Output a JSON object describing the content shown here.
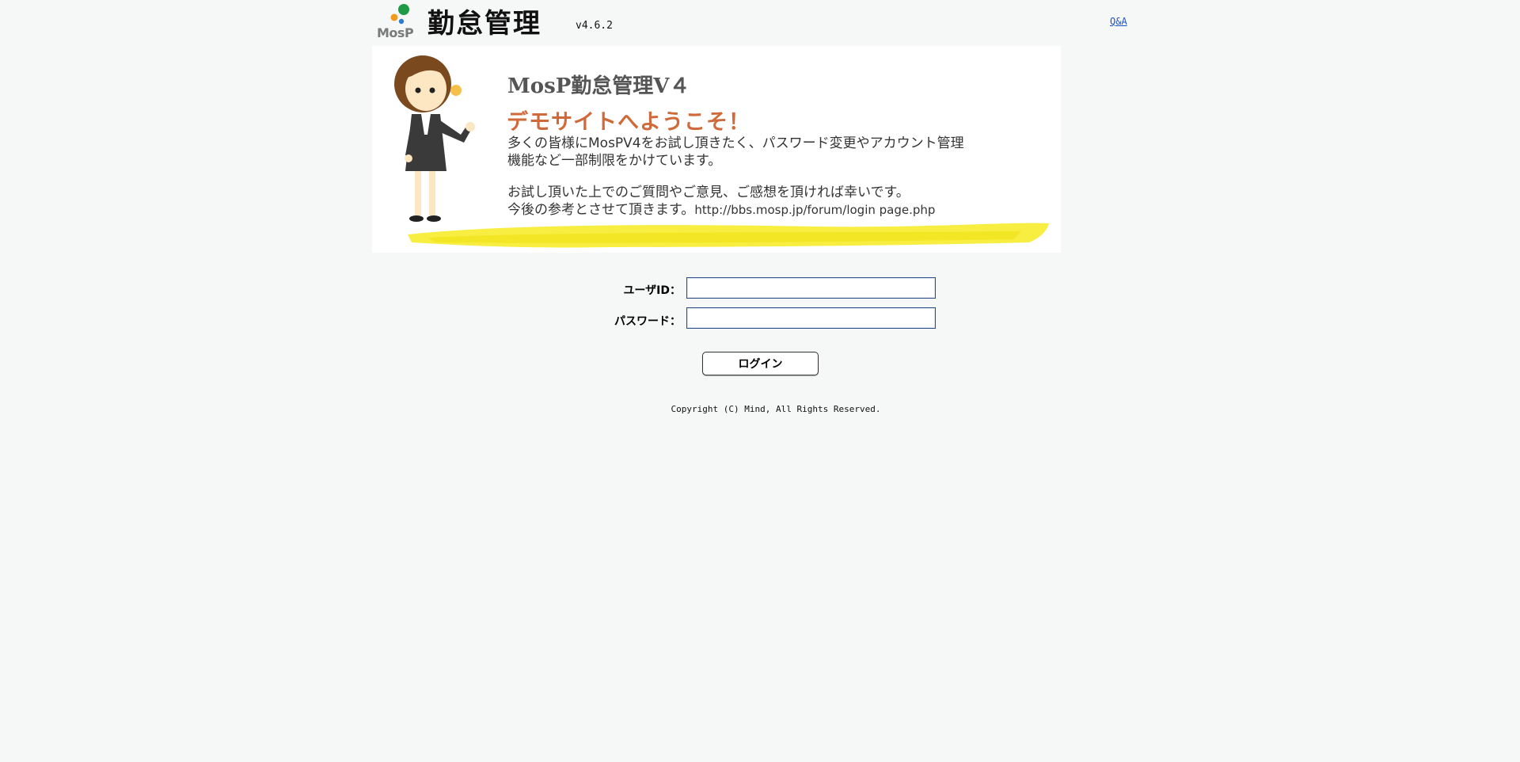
{
  "header": {
    "logo_text": "MosP",
    "app_title": "勤怠管理",
    "version": "v4.6.2",
    "qa_link": "Q&A"
  },
  "banner": {
    "title": "MosP勤怠管理V４",
    "welcome": "デモサイトへようこそ！",
    "paragraph1_line1": "多くの皆様にMosPV4をお試し頂きたく、パスワード変更やアカウント管理",
    "paragraph1_line2": "機能など一部制限をかけています。",
    "paragraph2_line1": "お試し頂いた上でのご質問やご意見、ご感想を頂ければ幸いです。",
    "paragraph2_line2": "今後の参考とさせて頂きます。",
    "url": "http://bbs.mosp.jp/forum/login page.php"
  },
  "login_form": {
    "user_id_label": "ユーザID：",
    "user_id_value": "",
    "password_label": "パスワード：",
    "password_value": "",
    "login_button": "ログイン"
  },
  "footer": {
    "copyright": "Copyright (C) Mind, All Rights Reserved."
  },
  "colors": {
    "background": "#f6f7f7",
    "link": "#1a55c7",
    "welcome_orange": "#d06a3a",
    "input_border": "#2b4f86",
    "highlight_yellow": "#f7ec2e"
  }
}
